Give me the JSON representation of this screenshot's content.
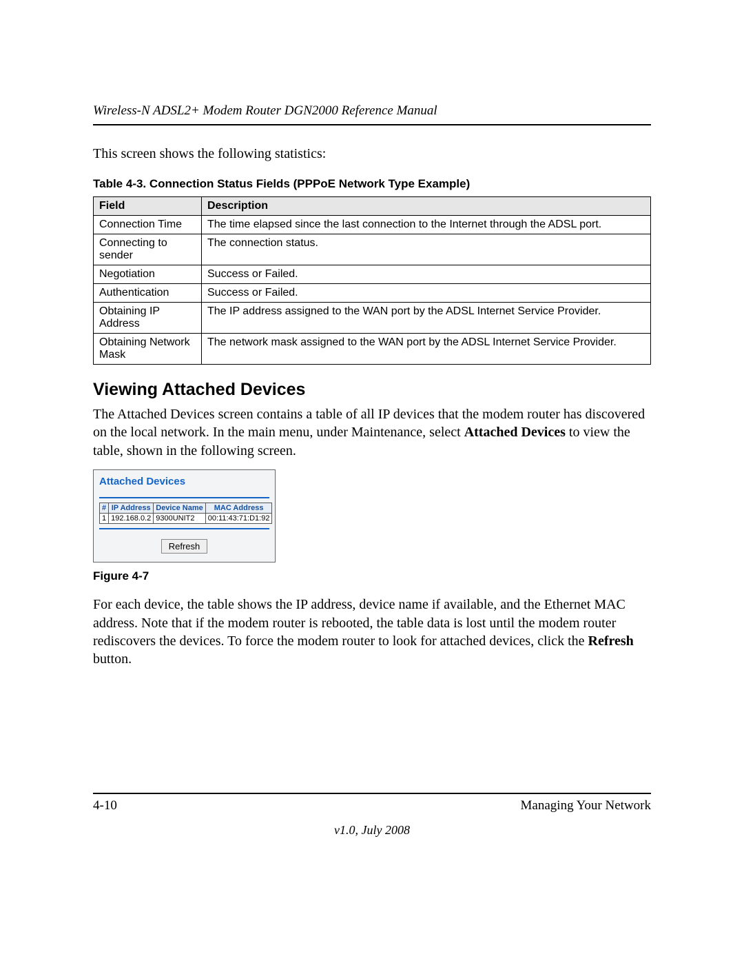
{
  "header": {
    "running_title": "Wireless-N ADSL2+ Modem Router DGN2000 Reference Manual"
  },
  "intro": {
    "line": "This screen shows the following statistics:"
  },
  "table43": {
    "caption": "Table 4-3.  Connection Status Fields (PPPoE Network Type Example)",
    "head_field": "Field",
    "head_desc": "Description",
    "rows": [
      {
        "field": "Connection Time",
        "desc": "The time elapsed since the last connection to the Internet through the ADSL port."
      },
      {
        "field": "Connecting to sender",
        "desc": "The connection status."
      },
      {
        "field": "Negotiation",
        "desc": "Success or Failed."
      },
      {
        "field": "Authentication",
        "desc": "Success or Failed."
      },
      {
        "field": "Obtaining IP Address",
        "desc": "The IP address assigned to the WAN port by the ADSL Internet Service Provider."
      },
      {
        "field": "Obtaining Network Mask",
        "desc": "The network mask assigned to the WAN port by the ADSL Internet Service Provider."
      }
    ]
  },
  "section": {
    "heading": "Viewing Attached Devices",
    "para1_pre": "The Attached Devices screen contains a table of all IP devices that the modem router has discovered on the local network. In the main menu, under Maintenance, select ",
    "para1_bold": "Attached Devices",
    "para1_post": " to view the table, shown in the following screen."
  },
  "inset": {
    "title": "Attached Devices",
    "columns": {
      "num": "#",
      "ip": "IP Address",
      "name": "Device Name",
      "mac": "MAC Address"
    },
    "rows": [
      {
        "num": "1",
        "ip": "192.168.0.2",
        "name": "9300UNIT2",
        "mac": "00:11:43:71:D1:92"
      }
    ],
    "refresh_label": "Refresh"
  },
  "figure": {
    "caption": "Figure 4-7"
  },
  "para2": {
    "pre": "For each device, the table shows the IP address, device name if available, and the Ethernet MAC address. Note that if the modem router is rebooted, the table data is lost until the modem router rediscovers the devices. To force the modem router to look for attached devices, click the ",
    "bold": "Refresh",
    "post": " button."
  },
  "footer": {
    "page_num": "4-10",
    "chapter": "Managing Your Network",
    "version": "v1.0, July 2008"
  }
}
